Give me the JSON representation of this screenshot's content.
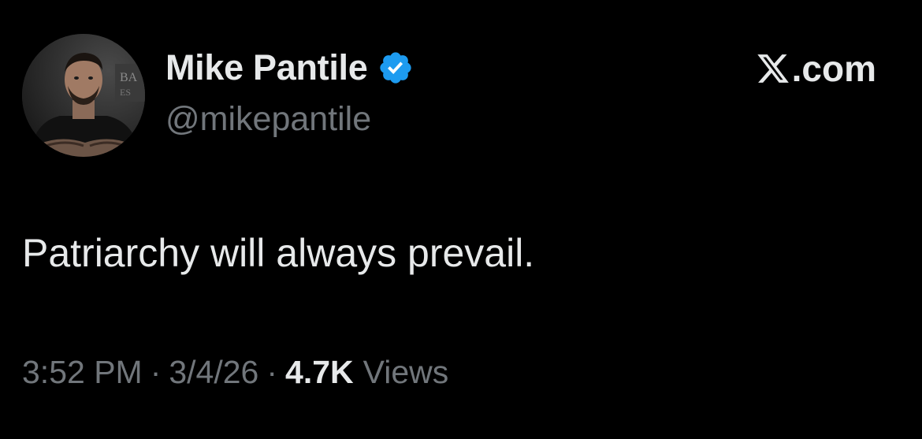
{
  "tweet": {
    "author": {
      "display_name": "Mike Pantile",
      "handle": "@mikepantile",
      "verified": true,
      "avatar_icon": "profile-photo",
      "avatar_sign_text": "BA ES"
    },
    "brand": {
      "logo_icon": "x-logo-icon",
      "suffix": ".com"
    },
    "text": "Patriarchy will always prevail.",
    "meta": {
      "time": "3:52 PM",
      "separator": "·",
      "date": "3/4/26",
      "views_count": "4.7K",
      "views_label": "Views"
    }
  },
  "colors": {
    "background": "#000000",
    "primary_text": "#e7e9ea",
    "secondary_text": "#71767b",
    "verified_badge": "#1d9bf0"
  }
}
